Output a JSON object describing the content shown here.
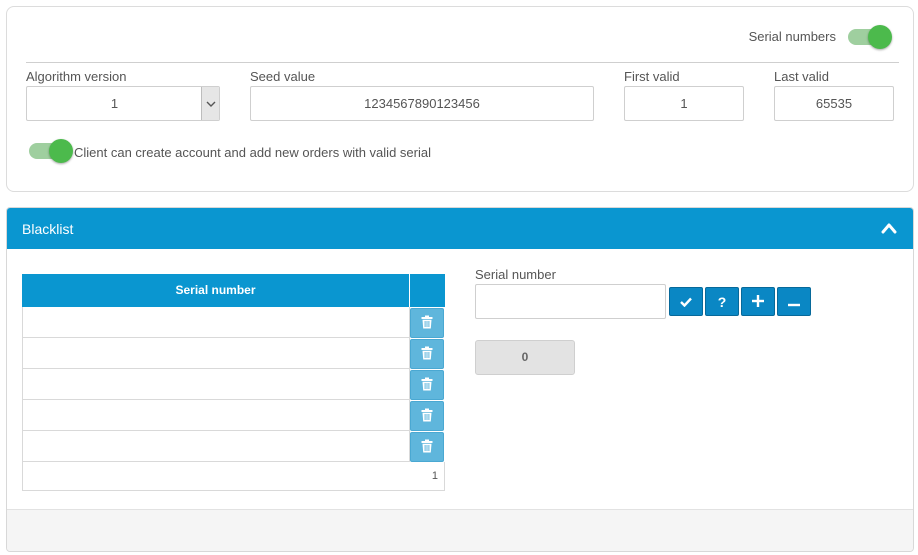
{
  "settings": {
    "serial_numbers_label": "Serial numbers",
    "serial_numbers_enabled": true,
    "algorithm_version": {
      "label": "Algorithm version",
      "value": "1"
    },
    "seed_value": {
      "label": "Seed value",
      "value": "1234567890123456"
    },
    "first_valid": {
      "label": "First valid",
      "value": "1"
    },
    "last_valid": {
      "label": "Last valid",
      "value": "65535"
    },
    "client_toggle_label": "Client can create account and add new orders with valid serial",
    "client_toggle_enabled": true
  },
  "blacklist": {
    "title": "Blacklist",
    "table": {
      "column_header": "Serial number",
      "rows": [
        "",
        "",
        "",
        "",
        ""
      ],
      "page_count": "1"
    },
    "entry": {
      "label": "Serial number",
      "value": "",
      "buttons": [
        "check-icon",
        "question-icon",
        "plus-icon",
        "minus-icon"
      ],
      "count": "0"
    }
  },
  "colors": {
    "accent": "#0a96d0",
    "toggle_on": "#4cba4c",
    "delete_button": "#5fb6dc"
  }
}
